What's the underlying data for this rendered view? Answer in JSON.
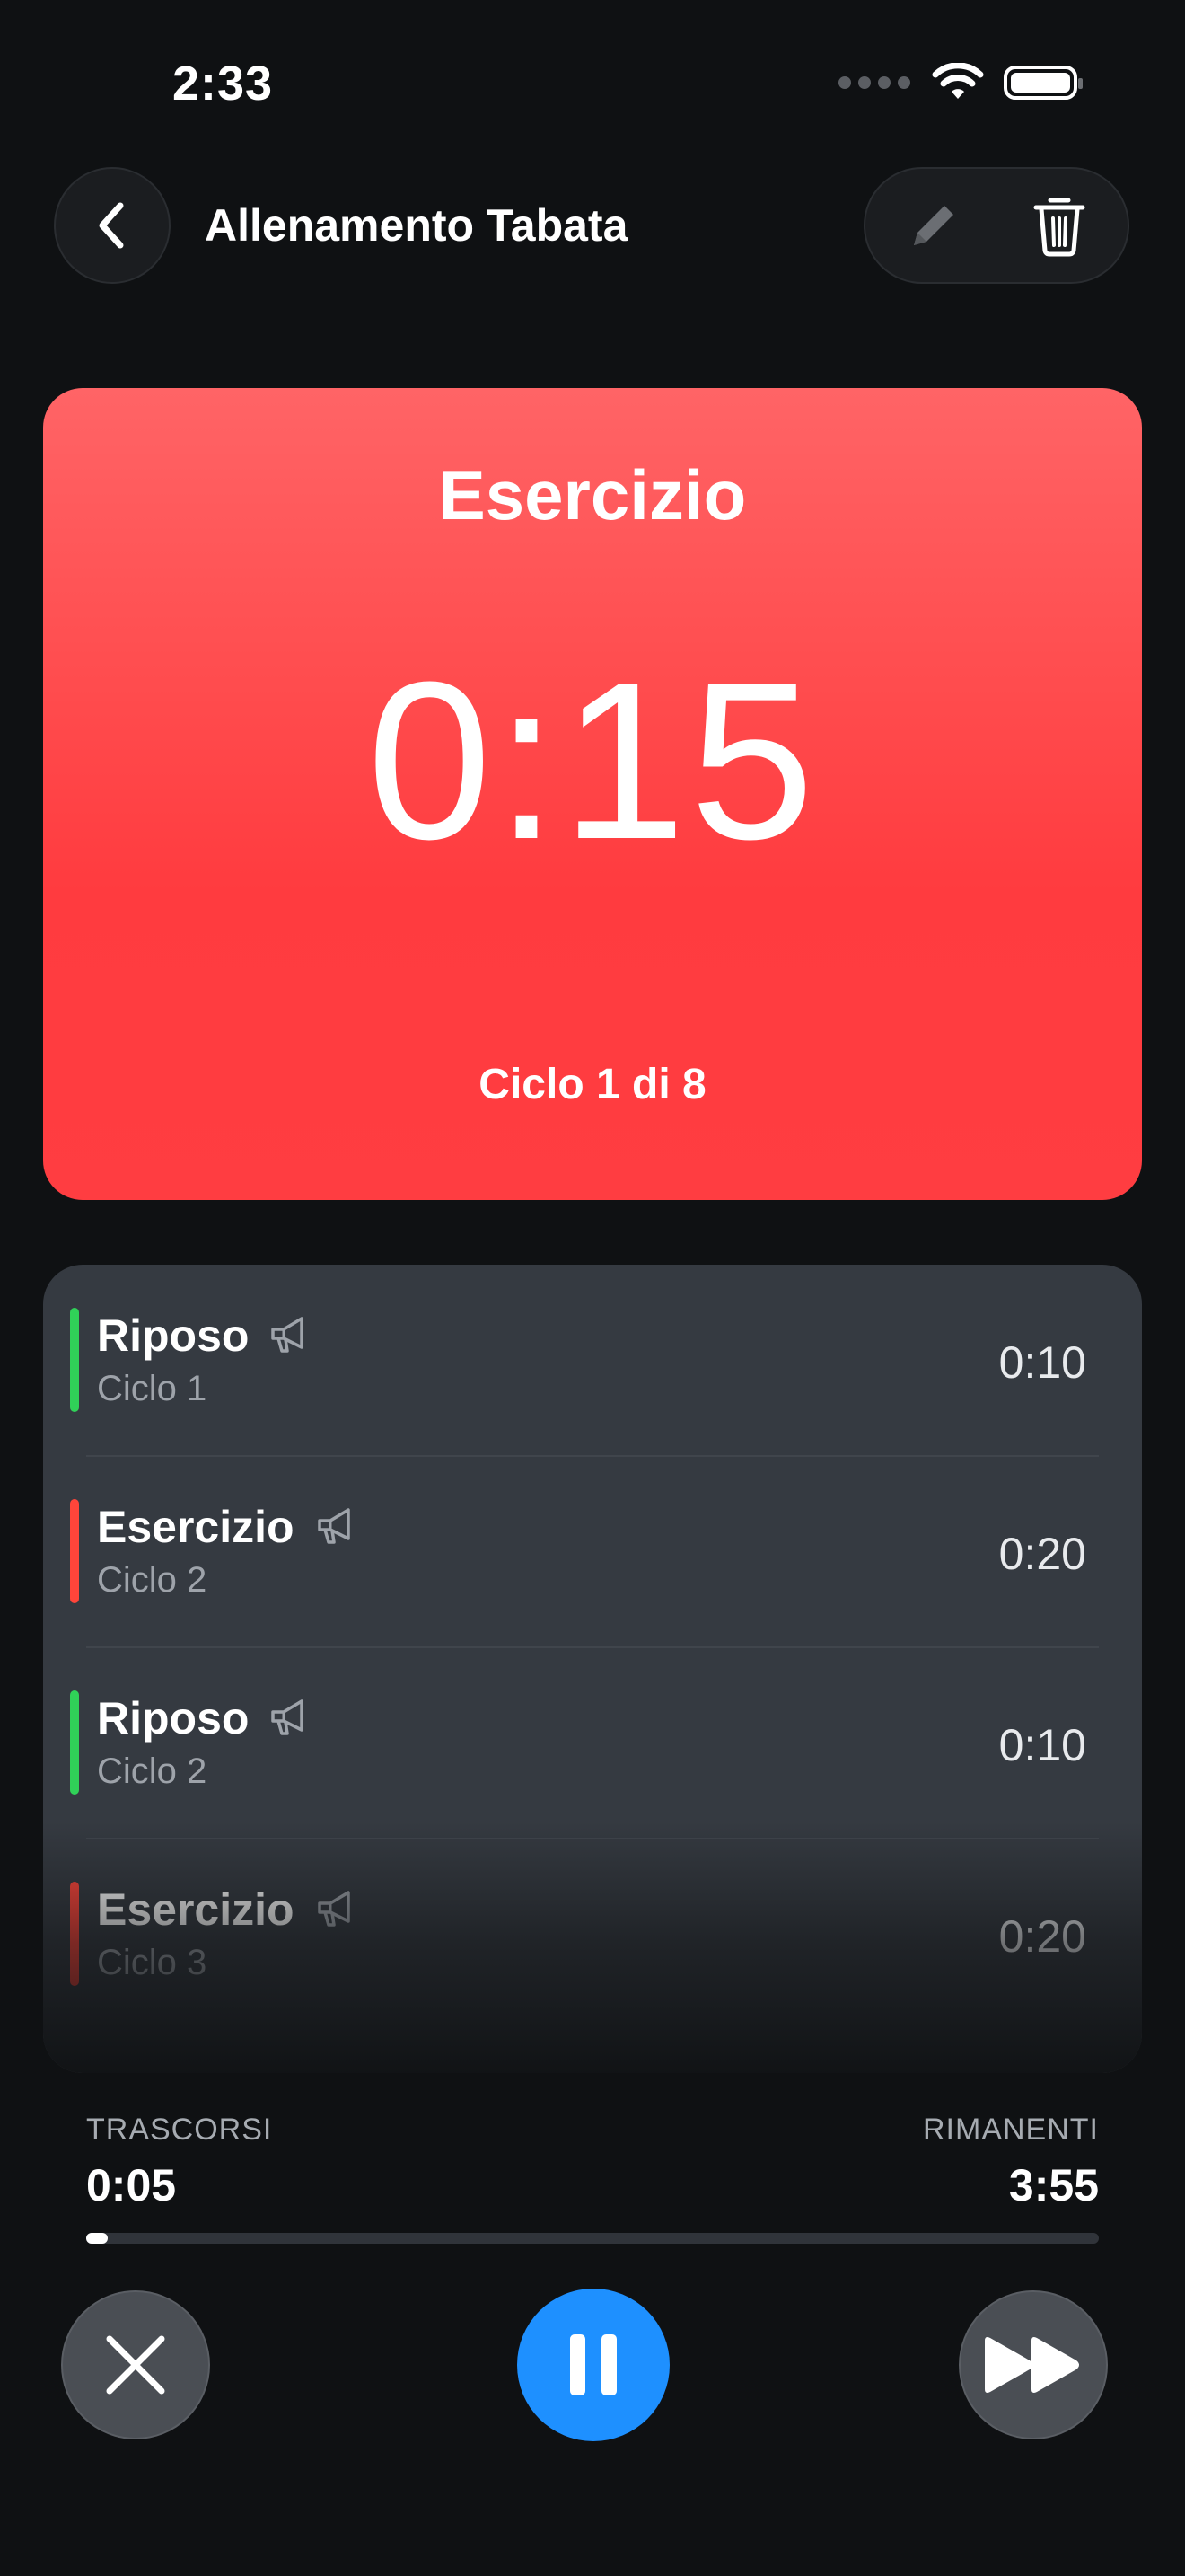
{
  "status_bar": {
    "time": "2:33"
  },
  "header": {
    "title": "Allenamento Tabata"
  },
  "icons": {
    "back": "chevron-left-icon",
    "edit": "pencil-icon",
    "delete": "trash-icon",
    "announce": "megaphone-icon",
    "cancel": "close-icon",
    "pause": "pause-icon",
    "skip": "fast-forward-icon"
  },
  "timer": {
    "phase": "Esercizio",
    "value": "0:15",
    "cycle": "Ciclo 1 di 8"
  },
  "steps": [
    {
      "name": "Riposo",
      "cycle": "Ciclo 1",
      "duration": "0:10",
      "color": "#30d158"
    },
    {
      "name": "Esercizio",
      "cycle": "Ciclo 2",
      "duration": "0:20",
      "color": "#ff453a"
    },
    {
      "name": "Riposo",
      "cycle": "Ciclo 2",
      "duration": "0:10",
      "color": "#30d158"
    },
    {
      "name": "Esercizio",
      "cycle": "Ciclo 3",
      "duration": "0:20",
      "color": "#ff453a"
    }
  ],
  "progress": {
    "elapsed_label": "TRASCORSI",
    "elapsed_value": "0:05",
    "remaining_label": "RIMANENTI",
    "remaining_value": "3:55",
    "fraction": 0.021
  },
  "colors": {
    "accent": "#1e90ff",
    "exercise": "#ff453a",
    "rest": "#30d158",
    "background": "#0f1113"
  }
}
